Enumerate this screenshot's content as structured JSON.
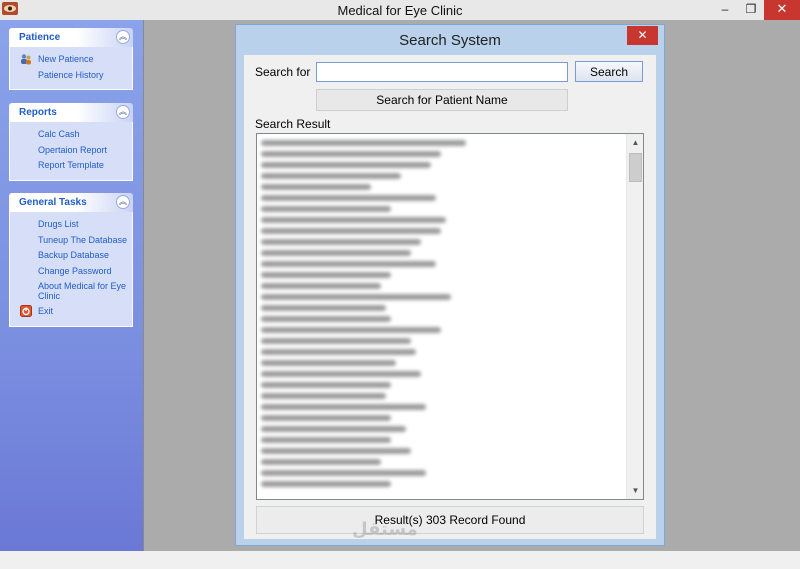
{
  "window": {
    "title": "Medical for Eye Clinic",
    "controls": {
      "minimize": "–",
      "restore": "❐",
      "close": "✕"
    }
  },
  "sidebar": {
    "panels": [
      {
        "title": "Patience",
        "items": [
          {
            "label": "New Patience",
            "icon": "users-icon"
          },
          {
            "label": "Patience History",
            "icon": ""
          }
        ]
      },
      {
        "title": "Reports",
        "items": [
          {
            "label": "Calc Cash"
          },
          {
            "label": "Opertaion Report"
          },
          {
            "label": "Report Template"
          }
        ]
      },
      {
        "title": "General Tasks",
        "items": [
          {
            "label": "Drugs List"
          },
          {
            "label": "Tuneup The Database"
          },
          {
            "label": "Backup Database"
          },
          {
            "label": "Change Password"
          },
          {
            "label": "About Medical for Eye Clinic"
          },
          {
            "label": "Exit",
            "icon": "exit-icon"
          }
        ]
      }
    ],
    "collapse_glyph": "︽"
  },
  "search_dialog": {
    "title": "Search System",
    "close_glyph": "✕",
    "search_label": "Search for",
    "search_value": "",
    "search_button": "Search",
    "hint": "Search for Patient Name",
    "result_label": "Search Result",
    "result_status": "Result(s) 303 Record Found",
    "scroll_up": "▲",
    "scroll_down": "▼"
  },
  "watermark": "مستقل"
}
